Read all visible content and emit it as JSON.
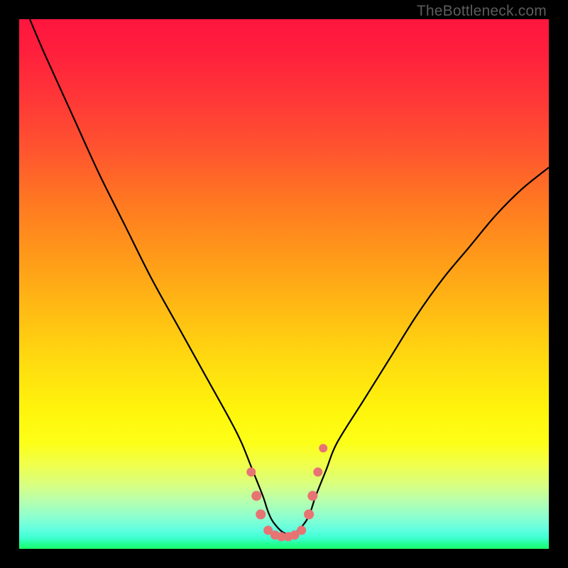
{
  "attribution": "TheBottleneck.com",
  "colors": {
    "frame": "#000000",
    "curve_stroke": "#000000",
    "marker_fill": "#e77373",
    "marker_stroke": "#c95a5a",
    "attribution_text": "#5c5c5c"
  },
  "chart_data": {
    "type": "line",
    "title": "",
    "xlabel": "",
    "ylabel": "",
    "xlim": [
      0,
      100
    ],
    "ylim": [
      0,
      100
    ],
    "grid": false,
    "series": [
      {
        "name": "bottleneck-curve",
        "x": [
          2,
          5,
          10,
          15,
          20,
          25,
          30,
          35,
          40,
          42,
          44,
          46,
          47,
          48,
          50,
          52,
          54,
          55,
          56,
          58,
          60,
          65,
          70,
          75,
          80,
          85,
          90,
          95,
          100
        ],
        "y": [
          100,
          93,
          82,
          71,
          61,
          51,
          42,
          33,
          24,
          20,
          15,
          10,
          7,
          5,
          3,
          3,
          5,
          7,
          10,
          15,
          20,
          28,
          36,
          44,
          51,
          57,
          63,
          68,
          72
        ]
      }
    ],
    "minimum_markers": {
      "name": "optimal-region-markers",
      "x": [
        43.8,
        44.8,
        45.6,
        47.0,
        48.3,
        49.5,
        50.8,
        52.0,
        53.3,
        54.7,
        55.4,
        56.4,
        57.4
      ],
      "y": [
        14.5,
        10.0,
        6.5,
        3.5,
        2.6,
        2.3,
        2.3,
        2.6,
        3.5,
        6.5,
        10.0,
        14.5,
        19.0
      ],
      "r": [
        6.5,
        7.0,
        7.0,
        6.5,
        6.5,
        6.5,
        6.5,
        6.5,
        6.5,
        7.0,
        7.0,
        6.5,
        6.0
      ]
    },
    "background_gradient": {
      "orientation": "vertical",
      "stops": [
        {
          "offset": 0.0,
          "color": "#ff163e"
        },
        {
          "offset": 0.34,
          "color": "#ff7622"
        },
        {
          "offset": 0.64,
          "color": "#ffd910"
        },
        {
          "offset": 0.8,
          "color": "#fdff18"
        },
        {
          "offset": 0.91,
          "color": "#b6ffae"
        },
        {
          "offset": 1.0,
          "color": "#1aff6a"
        }
      ]
    }
  }
}
